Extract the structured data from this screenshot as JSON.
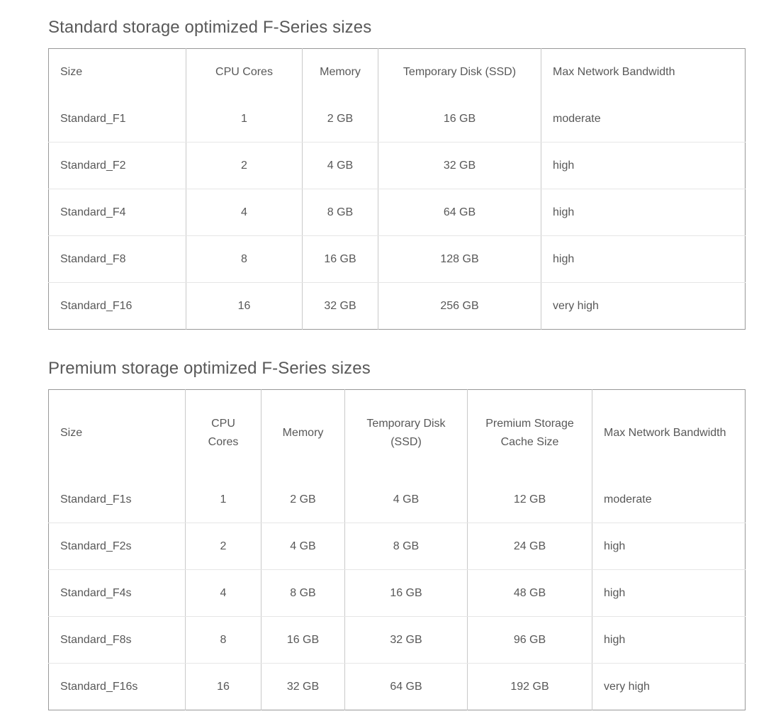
{
  "page": {
    "background_color": "#ffffff",
    "text_color": "#585858",
    "heading_color": "#595959",
    "table_border_color": "#989898",
    "row_divider_color": "#e6e6e6",
    "column_divider_color": "#c9c9c9"
  },
  "sections": [
    {
      "id": "standard-storage-optimized",
      "title": "Standard storage optimized F-Series sizes",
      "table": {
        "columns": [
          {
            "label": "Size",
            "align": "left"
          },
          {
            "label": "CPU Cores",
            "align": "center"
          },
          {
            "label": "Memory",
            "align": "center"
          },
          {
            "label": "Temporary Disk (SSD)",
            "align": "center"
          },
          {
            "label": "Max Network Bandwidth",
            "align": "left"
          }
        ],
        "rows": [
          [
            "Standard_F1",
            "1",
            "2 GB",
            "16 GB",
            "moderate"
          ],
          [
            "Standard_F2",
            "2",
            "4 GB",
            "32 GB",
            "high"
          ],
          [
            "Standard_F4",
            "4",
            "8 GB",
            "64 GB",
            "high"
          ],
          [
            "Standard_F8",
            "8",
            "16 GB",
            "128 GB",
            "high"
          ],
          [
            "Standard_F16",
            "16",
            "32 GB",
            "256 GB",
            "very high"
          ]
        ]
      }
    },
    {
      "id": "premium-storage-optimized",
      "title": "Premium storage optimized F-Series sizes",
      "table": {
        "columns": [
          {
            "label": "Size",
            "align": "left"
          },
          {
            "label": "CPU Cores",
            "align": "center"
          },
          {
            "label": "Memory",
            "align": "center"
          },
          {
            "label": "Temporary Disk (SSD)",
            "align": "center"
          },
          {
            "label": "Premium Storage Cache Size",
            "align": "center"
          },
          {
            "label": "Max Network Bandwidth",
            "align": "left"
          }
        ],
        "rows": [
          [
            "Standard_F1s",
            "1",
            "2 GB",
            "4 GB",
            "12 GB",
            "moderate"
          ],
          [
            "Standard_F2s",
            "2",
            "4 GB",
            "8 GB",
            "24 GB",
            "high"
          ],
          [
            "Standard_F4s",
            "4",
            "8 GB",
            "16 GB",
            "48 GB",
            "high"
          ],
          [
            "Standard_F8s",
            "8",
            "16 GB",
            "32 GB",
            "96 GB",
            "high"
          ],
          [
            "Standard_F16s",
            "16",
            "32 GB",
            "64 GB",
            "192 GB",
            "very high"
          ]
        ]
      }
    }
  ]
}
